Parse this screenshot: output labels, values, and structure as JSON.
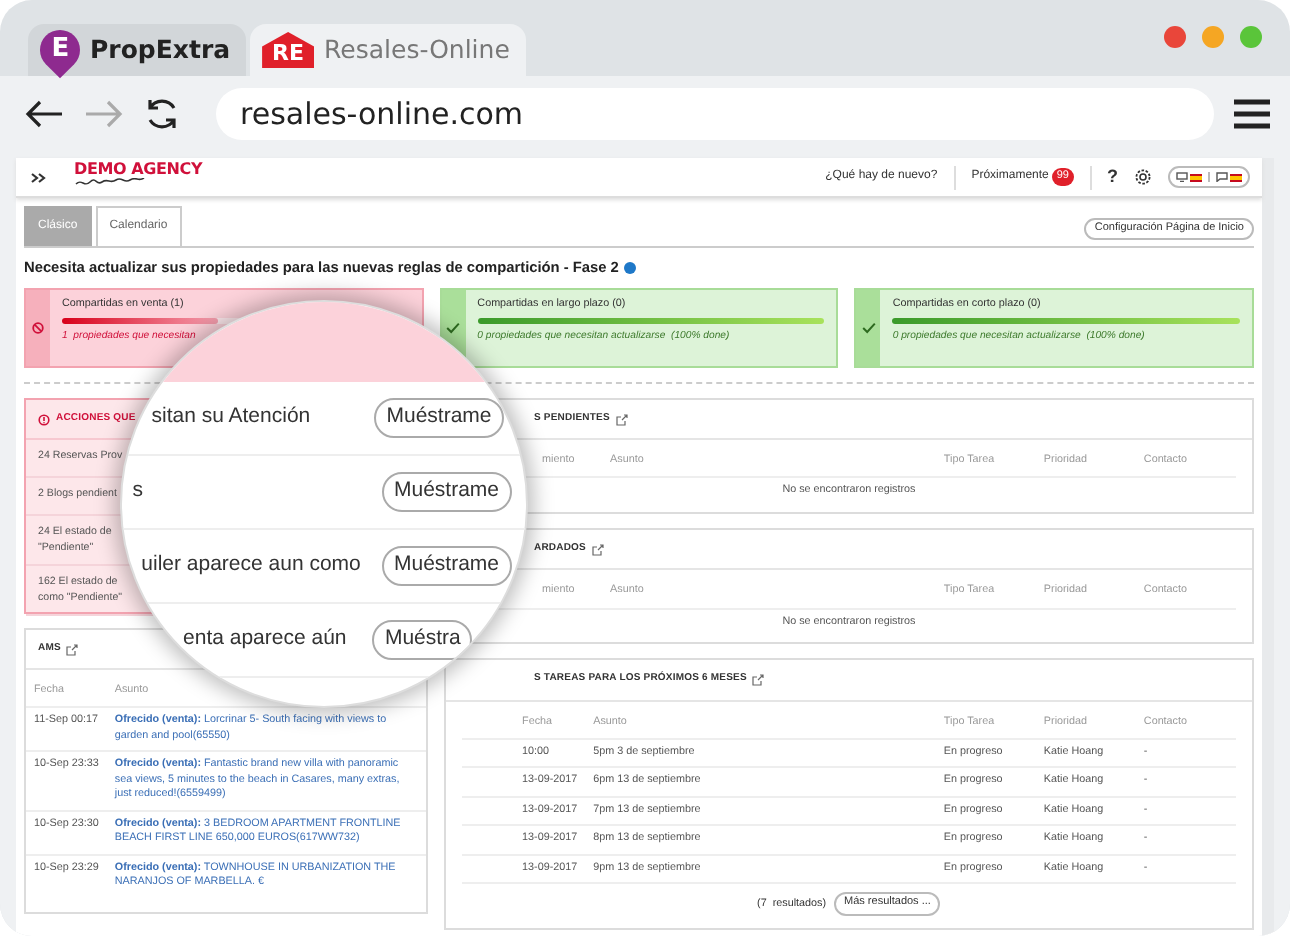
{
  "browser": {
    "tabs": [
      {
        "label": "PropExtra",
        "favicon_letter": "E",
        "kind": "pin",
        "selected": false
      },
      {
        "label": "Resales-Online",
        "favicon_letter": "RE",
        "kind": "house",
        "selected": true
      }
    ],
    "address": "resales-online.com"
  },
  "app_header": {
    "logo_text": "DEMO AGENCY",
    "whats_new": "¿Qué hay de nuevo?",
    "upcoming": "Próximamente",
    "upcoming_count": "99",
    "help": "?"
  },
  "view_tabs": [
    {
      "label": "Clásico",
      "selected": true
    },
    {
      "label": "Calendario",
      "selected": false
    }
  ],
  "config_button": "Configuración Página de Inicio",
  "heading": "Necesita actualizar sus propiedades para las nuevas reglas de compartición - Fase 2",
  "status_cards": [
    {
      "title": "Compartidas en venta (1)",
      "error": true,
      "level": 0.45,
      "note": "1  propiedades que necesitan"
    },
    {
      "title": "Compartidas en largo plazo (0)",
      "error": false,
      "level": 1,
      "note": "0 propiedades que necesitan actualizarse  (100% done)"
    },
    {
      "title": "Compartidas en corto plazo (0)",
      "error": false,
      "level": 1,
      "note": "0 propiedades que necesitan actualizarse  (100% done)"
    }
  ],
  "actions_panel": {
    "title": "ACCIONES QUE",
    "items": [
      {
        "lines": [
          "24 Reservas Prov"
        ]
      },
      {
        "lines": [
          "2 Blogs pendient"
        ]
      },
      {
        "lines": [
          "24 El estado de",
          "\"Pendiente\""
        ]
      },
      {
        "lines": [
          "162 El estado de",
          "como \"Pendiente\""
        ]
      }
    ]
  },
  "ams_panel": {
    "title": "AMS",
    "columns": [
      "Fecha",
      "Asunto"
    ],
    "rows": [
      {
        "date": "11-Sep 00:17",
        "label": "Ofrecido (venta):",
        "text": "Lorcrinar 5- South facing with views to garden and pool(65550)"
      },
      {
        "date": "10-Sep 23:33",
        "label": "Ofrecido (venta):",
        "text": "Fantastic brand new villa with panoramic sea views, 5 minutes to the beach in Casares, many extras, just reduced!(6559499)"
      },
      {
        "date": "10-Sep 23:30",
        "label": "Ofrecido (venta):",
        "text": "3 BEDROOM APARTMENT FRONTLINE BEACH FIRST LINE 650,000 EUROS(617WW732)"
      },
      {
        "date": "10-Sep 23:29",
        "label": "Ofrecido (venta):",
        "text": "TOWNHOUSE IN URBANIZATION THE NARANJOS OF MARBELLA. €"
      }
    ]
  },
  "task_panels": [
    {
      "title": "S PENDIENTES",
      "columns": [
        "miento",
        "Asunto",
        "Tipo Tarea",
        "Prioridad",
        "Contacto"
      ],
      "empty": "No se encontraron registros"
    },
    {
      "title": "ARDADOS",
      "columns": [
        "miento",
        "Asunto",
        "Tipo Tarea",
        "Prioridad",
        "Contacto"
      ],
      "empty": "No se encontraron registros"
    },
    {
      "title": "S TAREAS PARA LOS PRÓXIMOS 6 MESES",
      "columns": [
        "Fecha",
        "Asunto",
        "Tipo Tarea",
        "Prioridad",
        "Contacto"
      ],
      "rows": [
        {
          "cells": [
            "10:00",
            "5pm 3 de septiembre",
            "En progreso",
            "Katie Hoang",
            "-"
          ]
        },
        {
          "cells": [
            "13-09-2017",
            "6pm 13 de septiembre",
            "En progreso",
            "Katie Hoang",
            "-"
          ]
        },
        {
          "cells": [
            "13-09-2017",
            "7pm 13 de septiembre",
            "En progreso",
            "Katie Hoang",
            "-"
          ]
        },
        {
          "cells": [
            "13-09-2017",
            "8pm 13 de septiembre",
            "En progreso",
            "Katie Hoang",
            "-"
          ]
        },
        {
          "cells": [
            "13-09-2017",
            "9pm 13 de septiembre",
            "En progreso",
            "Katie Hoang",
            "-"
          ]
        }
      ],
      "results": "(7  resultados)",
      "more_button": "Más resultados ..."
    }
  ],
  "magnifier": {
    "rows": [
      {
        "text": "sitan su Atención",
        "button": "Muéstrame"
      },
      {
        "text": "s",
        "button": "Muéstrame"
      },
      {
        "text": "uiler aparece aun como",
        "button": "Muéstrame"
      },
      {
        "text": "enta aparece aún",
        "button": "Muéstra"
      }
    ]
  }
}
